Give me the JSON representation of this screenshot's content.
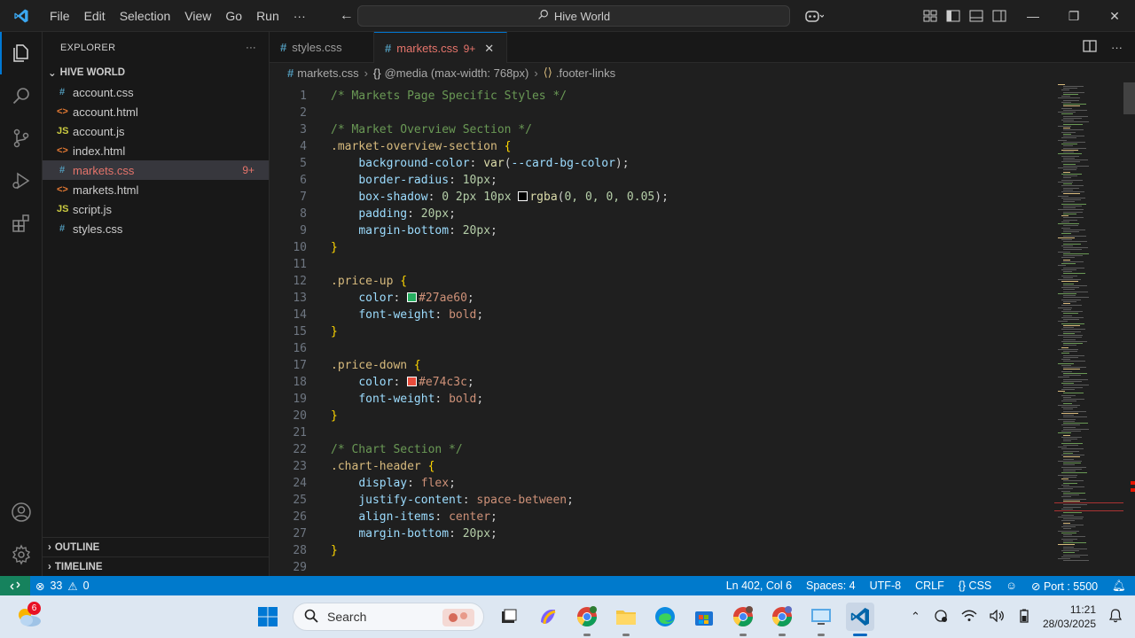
{
  "titlebar": {
    "menu": [
      "File",
      "Edit",
      "Selection",
      "View",
      "Go",
      "Run",
      "···"
    ],
    "command_center": "Hive World"
  },
  "explorer": {
    "title": "EXPLORER",
    "folder": "HIVE WORLD",
    "files": [
      {
        "name": "account.css",
        "type": "css"
      },
      {
        "name": "account.html",
        "type": "html"
      },
      {
        "name": "account.js",
        "type": "js"
      },
      {
        "name": "index.html",
        "type": "html"
      },
      {
        "name": "markets.css",
        "type": "css",
        "selected": true,
        "badge": "9+"
      },
      {
        "name": "markets.html",
        "type": "html"
      },
      {
        "name": "script.js",
        "type": "js"
      },
      {
        "name": "styles.css",
        "type": "css"
      }
    ],
    "outline": "OUTLINE",
    "timeline": "TIMELINE"
  },
  "tabs": [
    {
      "label": "styles.css",
      "active": false
    },
    {
      "label": "markets.css",
      "active": true,
      "count": "9+"
    }
  ],
  "breadcrumb": {
    "file": "markets.css",
    "media": "@media (max-width: 768px)",
    "selector": ".footer-links"
  },
  "editor": {
    "lines": [
      {
        "n": "1",
        "t": "comment",
        "text": "/* Markets Page Specific Styles */"
      },
      {
        "n": "2",
        "t": "blank"
      },
      {
        "n": "3",
        "t": "comment",
        "text": "/* Market Overview Section */"
      },
      {
        "n": "4",
        "t": "open",
        "sel": ".market-overview-section"
      },
      {
        "n": "5",
        "t": "decl",
        "prop": "background-color",
        "val": "var(--card-bg-color)",
        "kind": "var"
      },
      {
        "n": "6",
        "t": "decl",
        "prop": "border-radius",
        "val": "10px",
        "kind": "num"
      },
      {
        "n": "7",
        "t": "decl",
        "prop": "box-shadow",
        "val": "0 2px 10px ",
        "swatch": "#ffffff",
        "val2": "rgba(0, 0, 0, 0.05)",
        "kind": "shadow"
      },
      {
        "n": "8",
        "t": "decl",
        "prop": "padding",
        "val": "20px",
        "kind": "num"
      },
      {
        "n": "9",
        "t": "decl",
        "prop": "margin-bottom",
        "val": "20px",
        "kind": "num"
      },
      {
        "n": "10",
        "t": "close"
      },
      {
        "n": "11",
        "t": "blank"
      },
      {
        "n": "12",
        "t": "open",
        "sel": ".price-up"
      },
      {
        "n": "13",
        "t": "decl",
        "prop": "color",
        "val": "#27ae60",
        "swatch": "#27ae60",
        "kind": "color"
      },
      {
        "n": "14",
        "t": "decl",
        "prop": "font-weight",
        "val": "bold",
        "kind": "kw"
      },
      {
        "n": "15",
        "t": "close"
      },
      {
        "n": "16",
        "t": "blank"
      },
      {
        "n": "17",
        "t": "open",
        "sel": ".price-down"
      },
      {
        "n": "18",
        "t": "decl",
        "prop": "color",
        "val": "#e74c3c",
        "swatch": "#e74c3c",
        "kind": "color"
      },
      {
        "n": "19",
        "t": "decl",
        "prop": "font-weight",
        "val": "bold",
        "kind": "kw"
      },
      {
        "n": "20",
        "t": "close"
      },
      {
        "n": "21",
        "t": "blank"
      },
      {
        "n": "22",
        "t": "comment",
        "text": "/* Chart Section */"
      },
      {
        "n": "23",
        "t": "open",
        "sel": ".chart-header"
      },
      {
        "n": "24",
        "t": "decl",
        "prop": "display",
        "val": "flex",
        "kind": "kw"
      },
      {
        "n": "25",
        "t": "decl",
        "prop": "justify-content",
        "val": "space-between",
        "kind": "kw"
      },
      {
        "n": "26",
        "t": "decl",
        "prop": "align-items",
        "val": "center",
        "kind": "kw"
      },
      {
        "n": "27",
        "t": "decl",
        "prop": "margin-bottom",
        "val": "20px",
        "kind": "num"
      },
      {
        "n": "28",
        "t": "close"
      },
      {
        "n": "29",
        "t": "blank"
      }
    ]
  },
  "statusbar": {
    "errors": "33",
    "warnings": "0",
    "position": "Ln 402, Col 6",
    "spaces": "Spaces: 4",
    "encoding": "UTF-8",
    "eol": "CRLF",
    "language": "CSS",
    "port": "Port : 5500"
  },
  "taskbar": {
    "weather_badge": "6",
    "search_placeholder": "Search",
    "time": "11:21",
    "date": "28/03/2025"
  },
  "colors": {
    "accent": "#007acc",
    "error": "#e5746b"
  }
}
